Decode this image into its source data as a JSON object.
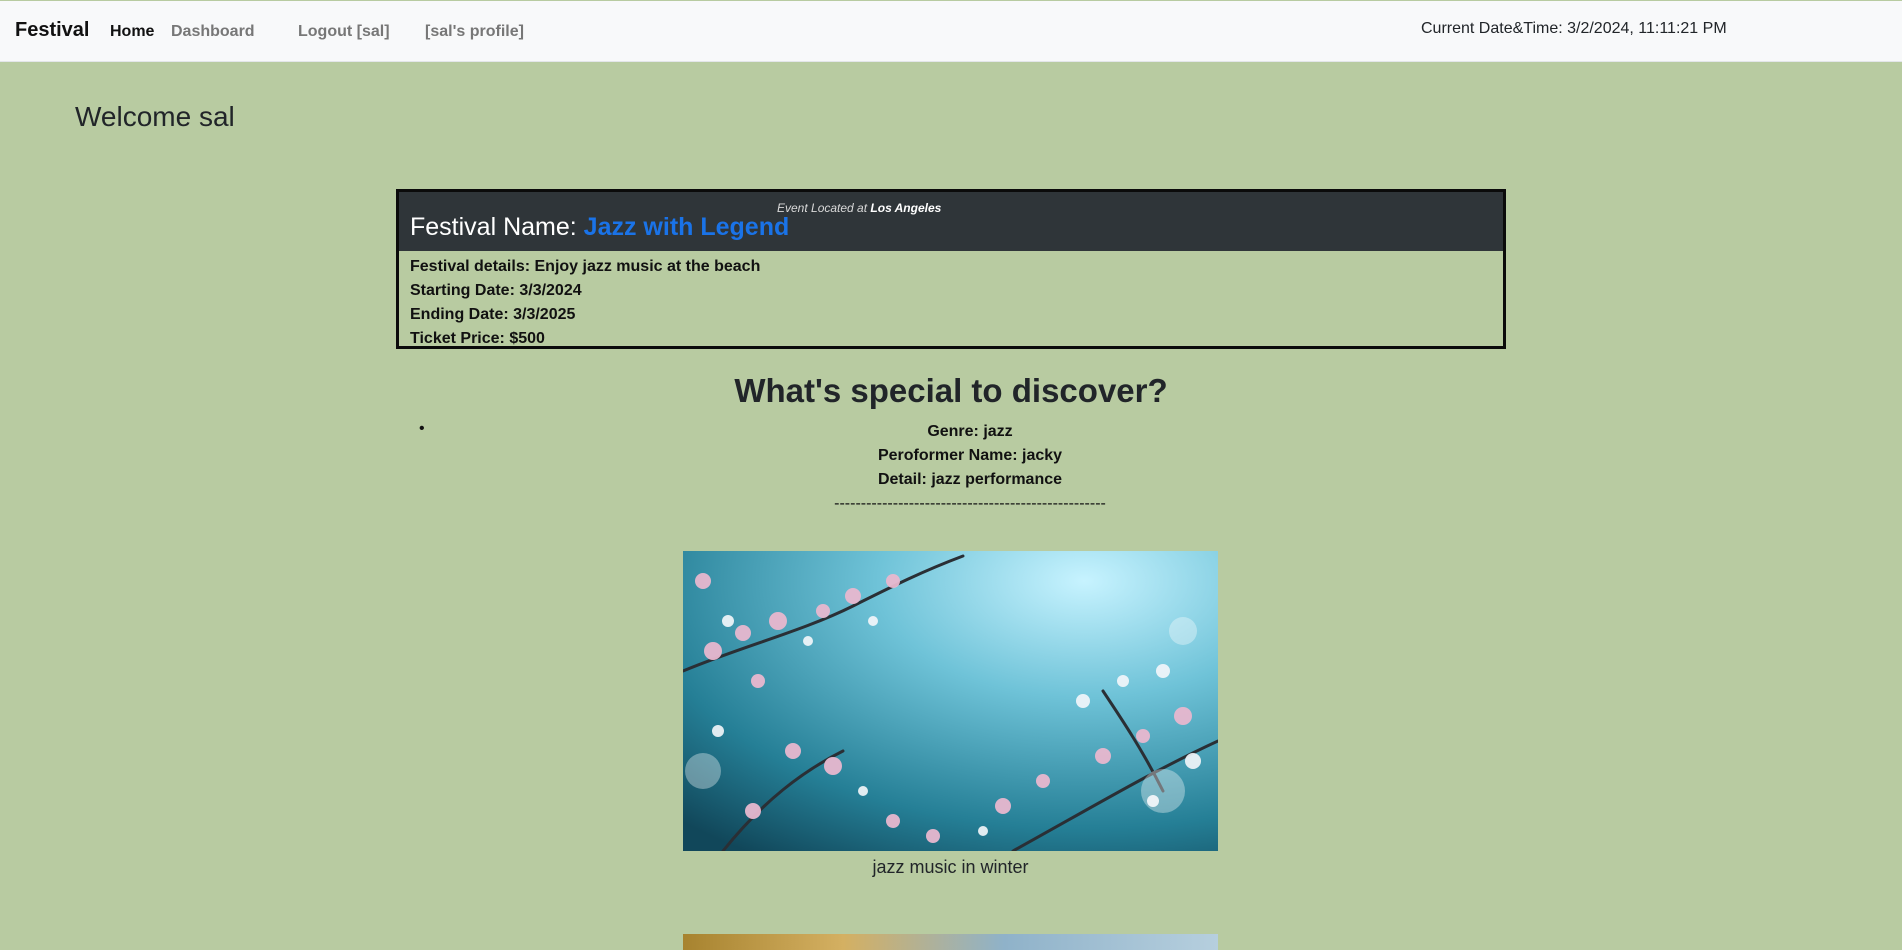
{
  "navbar": {
    "brand": "Festival",
    "links": [
      "Home",
      "Dashboard",
      "Logout [sal]",
      "[sal's profile]"
    ],
    "datetime": "Current Date&Time: 3/2/2024, 11:11:21 PM"
  },
  "welcome": "Welcome sal",
  "festival": {
    "location_prefix": "Event Located at",
    "location": "Los Angeles",
    "name_label": "Festival Name:",
    "name": "Jazz with Legend",
    "details": "Festival details: Enjoy jazz music at the beach",
    "start": "Starting Date: 3/3/2024",
    "end": "Ending Date: 3/3/2025",
    "price": "Ticket Price: $500"
  },
  "discover": {
    "title": "What's special to discover?",
    "items": [
      {
        "genre": "Genre: jazz",
        "performer": "Peroformer Name: jacky",
        "detail": "Detail: jazz performance",
        "divider": "---------------------------------------------------",
        "caption": "jazz music in winter"
      }
    ]
  },
  "colors": {
    "page_bg": "#b8cba1",
    "navbar_bg": "#f8f9fa",
    "card_header_bg": "#2f3539",
    "accent": "#1a73e8"
  }
}
